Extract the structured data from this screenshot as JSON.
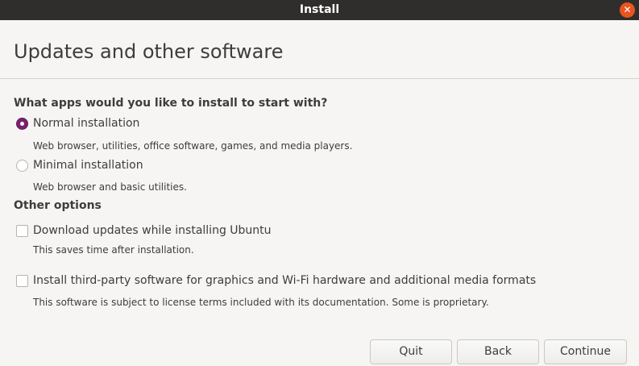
{
  "window": {
    "title": "Install",
    "close_glyph": "✕"
  },
  "page": {
    "title": "Updates and other software"
  },
  "apps_section": {
    "heading": "What apps would you like to install to start with?",
    "options": [
      {
        "label": "Normal installation",
        "description": "Web browser, utilities, office software, games, and media players.",
        "selected": true
      },
      {
        "label": "Minimal installation",
        "description": "Web browser and basic utilities.",
        "selected": false
      }
    ]
  },
  "other_section": {
    "heading": "Other options",
    "options": [
      {
        "label": "Download updates while installing Ubuntu",
        "description": "This saves time after installation.",
        "checked": false
      },
      {
        "label": "Install third-party software for graphics and Wi-Fi hardware and additional media formats",
        "description": "This software is subject to license terms included with its documentation. Some is proprietary.",
        "checked": false
      }
    ]
  },
  "buttons": {
    "quit": "Quit",
    "back": "Back",
    "continue": "Continue"
  },
  "colors": {
    "titlebar": "#302e2c",
    "accent_radio": "#77216f",
    "close": "#e95420"
  },
  "icons": {
    "close": "close-icon",
    "radio": "radio-button",
    "checkbox": "checkbox"
  }
}
